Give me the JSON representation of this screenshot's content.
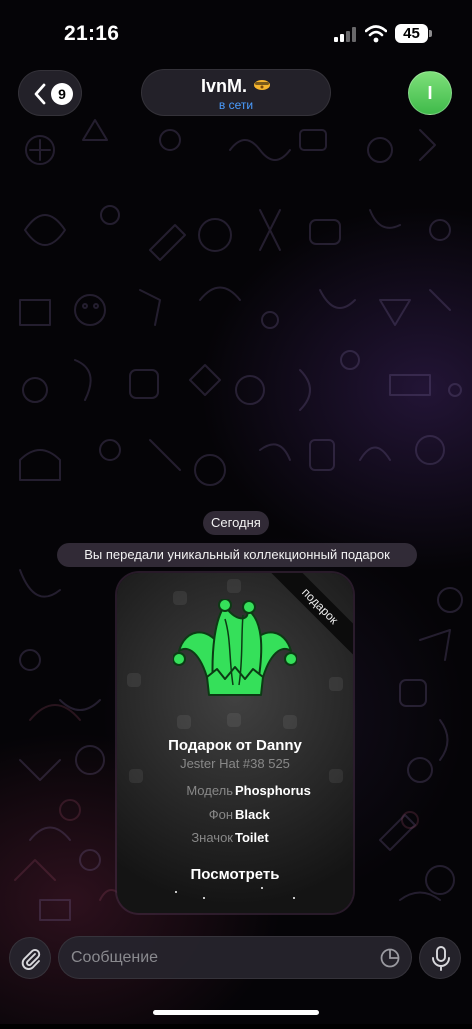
{
  "status_bar": {
    "time": "21:16",
    "battery": "45"
  },
  "header": {
    "back_count": "9",
    "chat_name": "IvnM.",
    "chat_status": "в сети",
    "avatar_letter": "I"
  },
  "messages": {
    "date": "Сегодня",
    "service_text": "Вы передали уникальный коллекционный подарок"
  },
  "gift": {
    "ribbon": "подарок",
    "title": "Подарок от Danny",
    "subtitle": "Jester Hat #38 525",
    "attributes": [
      {
        "key": "Модель",
        "value": "Phosphorus"
      },
      {
        "key": "Фон",
        "value": "Black"
      },
      {
        "key": "Значок",
        "value": "Toilet"
      }
    ],
    "view_label": "Посмотреть",
    "accent_color": "#35e05a"
  },
  "input": {
    "placeholder": "Сообщение"
  },
  "icons": {
    "back": "chevron-left-icon",
    "attach": "paperclip-icon",
    "sticker": "sticker-icon",
    "mic": "microphone-icon"
  }
}
